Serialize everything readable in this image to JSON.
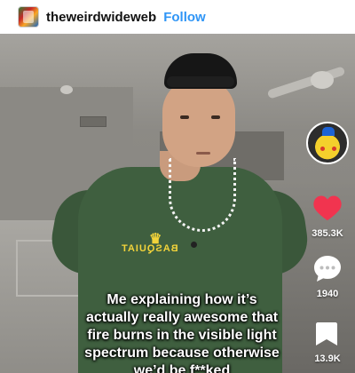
{
  "header": {
    "username": "theweirdwideweb",
    "follow_label": "Follow"
  },
  "video": {
    "caption_lines": [
      "Me explaining how it’s",
      "actually really awesome that",
      "fire burns in the visible light",
      "spectrum because otherwise",
      "we’d be f**ked"
    ],
    "shirt_text": "BASQUIAT"
  },
  "actions": {
    "likes": "385.3K",
    "comments": "1940",
    "saves": "13.9K"
  },
  "colors": {
    "follow": "#2f95f6",
    "heart": "#f1344f",
    "shirt": "#3f5f3f"
  }
}
